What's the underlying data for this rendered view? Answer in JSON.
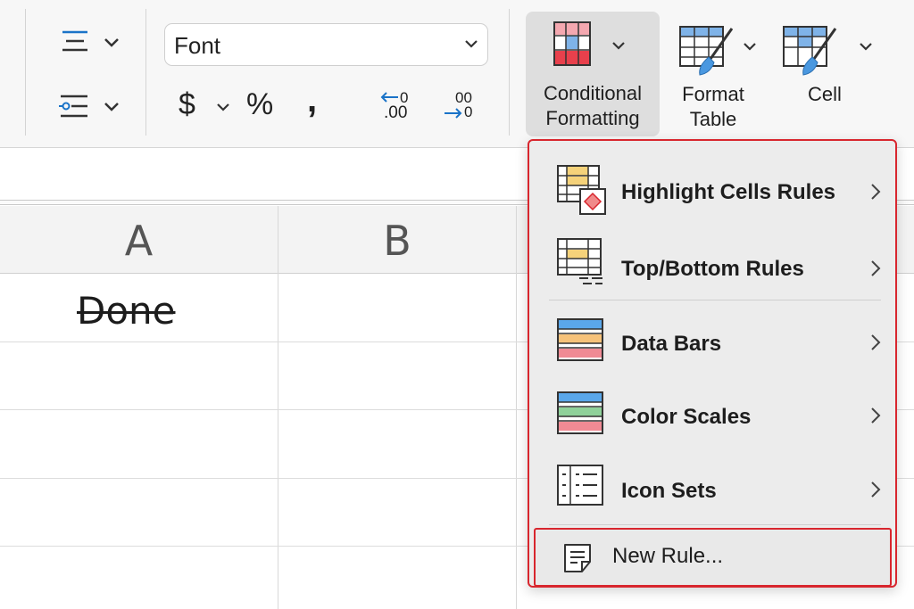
{
  "ribbon": {
    "font_select": {
      "value": "Font"
    },
    "number_format": {
      "currency_symbol": "$",
      "percent_symbol": "%",
      "comma_symbol": ",",
      "decrease_decimal_top": "0",
      "decrease_decimal_bottom": ".00",
      "increase_decimal_top": "00",
      "increase_decimal_bottom": "0"
    },
    "conditional_formatting": {
      "line1": "Conditional",
      "line2": "Formatting"
    },
    "format_table": {
      "line1": "Format",
      "line2": "Table"
    },
    "cell_styles": {
      "line1": "Cell"
    }
  },
  "sheet": {
    "columns": [
      "A",
      "B"
    ],
    "cells": {
      "A2": "Done"
    }
  },
  "menu": {
    "items": [
      {
        "label": "Highlight Cells Rules"
      },
      {
        "label": "Top/Bottom Rules"
      },
      {
        "label": "Data Bars"
      },
      {
        "label": "Color Scales"
      },
      {
        "label": "Icon Sets"
      }
    ],
    "new_rule": {
      "label": "New Rule..."
    }
  },
  "colors": {
    "accent_blue": "#1a73c8",
    "highlight_border": "#d8262e",
    "pressed_button": "#dedede"
  }
}
